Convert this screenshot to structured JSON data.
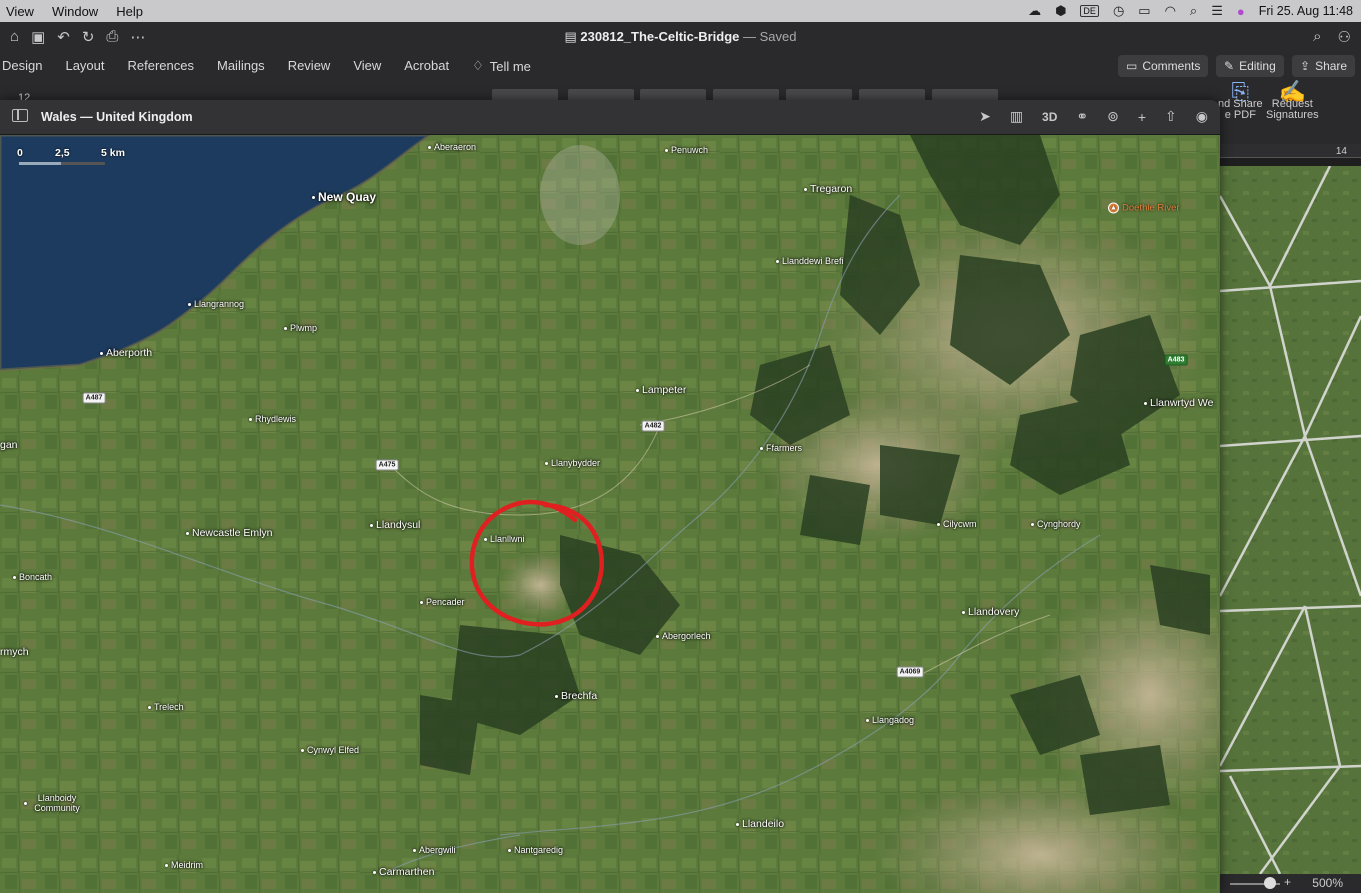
{
  "menubar": {
    "items": [
      "View",
      "Window",
      "Help"
    ],
    "clock": "Fri 25. Aug  11:48",
    "input_lang": "DE"
  },
  "word": {
    "doc_name": "230812_The-Celtic-Bridge",
    "doc_status": "— Saved",
    "tabs": [
      "Design",
      "Layout",
      "References",
      "Mailings",
      "Review",
      "View",
      "Acrobat"
    ],
    "tell_me": "Tell me",
    "comments_label": "Comments",
    "editing_label": "Editing",
    "share_label": "Share",
    "font_size": "12",
    "share_pdf_label_1": "nd Share",
    "share_pdf_label_2": "e PDF",
    "request_sig_label_1": "Request",
    "request_sig_label_2": "Signatures",
    "ruler_number": "14",
    "zoom": "500%"
  },
  "maps": {
    "window_title": "Wales — United Kingdom",
    "threed_label": "3D",
    "scale": {
      "zero": "0",
      "mid": "2,5",
      "end": "5 km"
    },
    "places": [
      {
        "name": "Aberaeron",
        "size": "small"
      },
      {
        "name": "Penuwch",
        "size": "small"
      },
      {
        "name": "Tregaron",
        "size": "medium"
      },
      {
        "name": "New Quay",
        "size": "large"
      },
      {
        "name": "Llanddewi Brefi",
        "size": "small"
      },
      {
        "name": "Llangrannog",
        "size": "small"
      },
      {
        "name": "Plwmp",
        "size": "small"
      },
      {
        "name": "Aberporth",
        "size": "medium"
      },
      {
        "name": "Lampeter",
        "size": "medium"
      },
      {
        "name": "Llanwrtyd We",
        "size": "medium"
      },
      {
        "name": "Rhydlewis",
        "size": "small"
      },
      {
        "name": "Ffarmers",
        "size": "small"
      },
      {
        "name": "gan",
        "size": "medium"
      },
      {
        "name": "Llanybydder",
        "size": "small"
      },
      {
        "name": "Newcastle Emlyn",
        "size": "medium"
      },
      {
        "name": "Llandysul",
        "size": "medium"
      },
      {
        "name": "Llanllwni",
        "size": "small"
      },
      {
        "name": "Cilycwm",
        "size": "small"
      },
      {
        "name": "Cynghordy",
        "size": "small"
      },
      {
        "name": "Boncath",
        "size": "small"
      },
      {
        "name": "Pencader",
        "size": "small"
      },
      {
        "name": "Llandovery",
        "size": "medium"
      },
      {
        "name": "Abergorlech",
        "size": "small"
      },
      {
        "name": "rmych",
        "size": "medium"
      },
      {
        "name": "Brechfa",
        "size": "medium"
      },
      {
        "name": "Trelech",
        "size": "small"
      },
      {
        "name": "Llangadog",
        "size": "small"
      },
      {
        "name": "Cynwyl Elfed",
        "size": "small"
      },
      {
        "name": "Llanboidy Community",
        "size": "small"
      },
      {
        "name": "Llandeilo",
        "size": "medium"
      },
      {
        "name": "Abergwili",
        "size": "small"
      },
      {
        "name": "Nantgaredig",
        "size": "small"
      },
      {
        "name": "Meidrim",
        "size": "small"
      },
      {
        "name": "Carmarthen",
        "size": "medium"
      }
    ],
    "roads": [
      "A487",
      "A475",
      "A482",
      "A4069",
      "A483"
    ],
    "poi": {
      "name": "Doethie River",
      "icon": "campsite-icon"
    }
  },
  "colors": {
    "annotation_circle": "#e02020",
    "sea": "#1d3b5e",
    "land": "#5c7a3c"
  }
}
